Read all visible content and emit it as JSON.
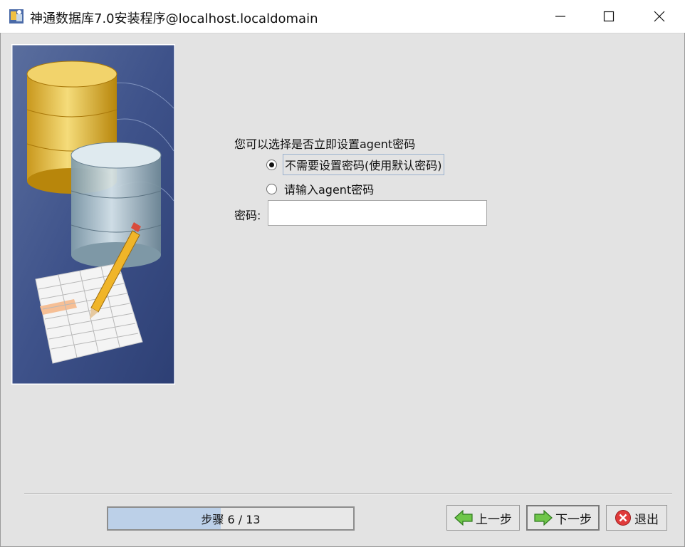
{
  "window": {
    "title": "神通数据库7.0安装程序@localhost.localdomain"
  },
  "page": {
    "prompt": "您可以选择是否立即设置agent密码",
    "options": [
      {
        "label": "不需要设置密码(使用默认密码)",
        "selected": true
      },
      {
        "label": "请输入agent密码",
        "selected": false
      }
    ],
    "password_label": "密码:",
    "password_value": ""
  },
  "footer": {
    "step_text": "步骤 6 / 13",
    "step_current": 6,
    "step_total": 13,
    "progress_fraction": 0.46,
    "back_label": "上一步",
    "next_label": "下一步",
    "exit_label": "退出"
  },
  "colors": {
    "progress_fill": "#bcd0e8",
    "side_panel": "#3b4f86"
  },
  "icons": [
    "app-icon",
    "minimize-icon",
    "maximize-icon",
    "close-icon",
    "back-arrow-icon",
    "next-arrow-icon",
    "exit-icon"
  ]
}
